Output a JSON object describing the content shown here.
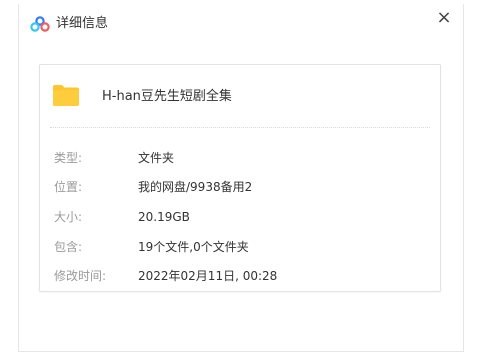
{
  "window": {
    "title": "详细信息",
    "close_glyph": "×",
    "app_icon": "baidu-netdisk-icon",
    "brand_colors": [
      "#2e7df6",
      "#38c7f3",
      "#f25c5c"
    ]
  },
  "file": {
    "icon": "folder-icon",
    "icon_color": "#ffc42e",
    "name": "H-han豆先生短剧全集"
  },
  "details": [
    {
      "label": "类型:",
      "value": "文件夹"
    },
    {
      "label": "位置:",
      "value": "我的网盘/9938备用2"
    },
    {
      "label": "大小:",
      "value": "20.19GB"
    },
    {
      "label": "包含:",
      "value": "19个文件,0个文件夹"
    },
    {
      "label": "修改时间:",
      "value": "2022年02月11日, 00:28"
    }
  ]
}
